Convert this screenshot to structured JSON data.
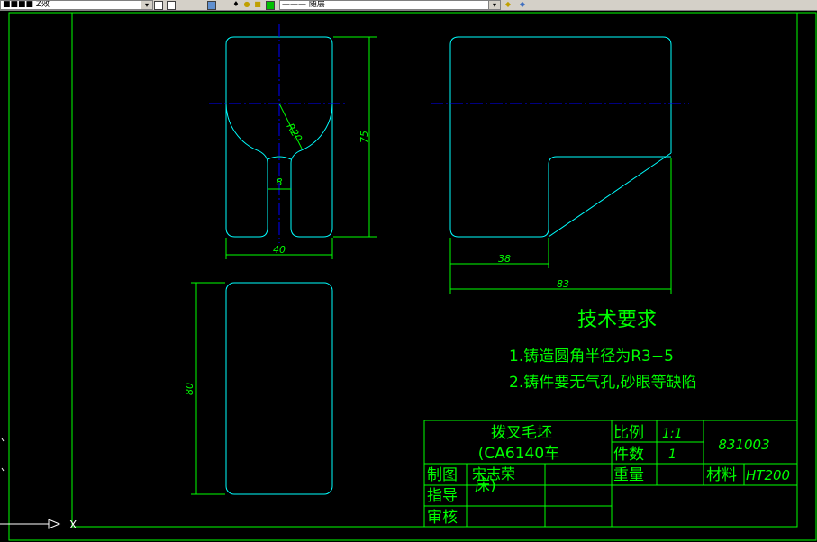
{
  "toolbar": {
    "layer_field": "■■■■  Z效",
    "layer_dropdown": "▾",
    "linetype_field": "——— 随层",
    "linetype_dropdown": "▾"
  },
  "drawing": {
    "tech_title": "技术要求",
    "tech_line1": "1.铸造圆角半径为R3−5",
    "tech_line2": "2.铸件要无气孔,砂眼等缺陷",
    "dims": {
      "r20": "R20",
      "d75": "75",
      "d8": "8",
      "d40": "40",
      "d38": "38",
      "d83": "83",
      "d80": "80"
    }
  },
  "title_block": {
    "part_name_line1": "拨叉毛坯",
    "part_name_line2": "(CA6140车",
    "part_name_line3": "床)",
    "scale_label": "比例",
    "scale_value": "1:1",
    "count_label": "件数",
    "count_value": "1",
    "weight_label": "重量",
    "material_label": "材料",
    "material_value": "HT200",
    "drawing_no": "831003",
    "drawn_label": "制图",
    "drawn_name": "宋志荣",
    "guide_label": "指导",
    "review_label": "审核"
  },
  "ucs": {
    "x_label": "X"
  },
  "colors": {
    "border": "#00ff00",
    "outline": "#00ffff",
    "centerline": "#0000ff",
    "dim": "#00ff00",
    "text": "#00ff00",
    "background": "#000000"
  }
}
